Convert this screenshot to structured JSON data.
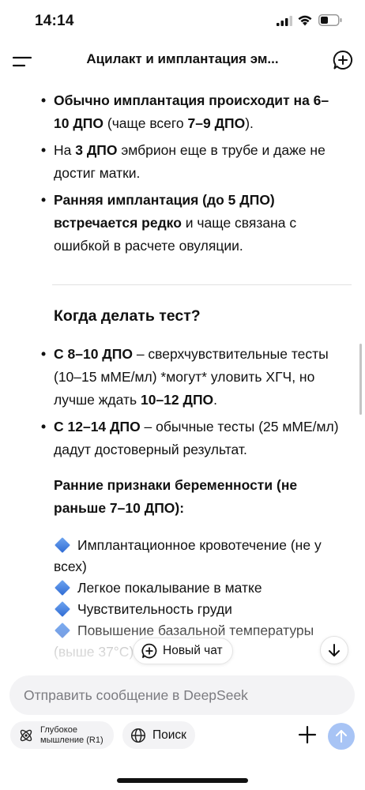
{
  "status_bar": {
    "time": "14:14"
  },
  "header": {
    "title": "Ацилакт и имплантация эм..."
  },
  "intro_bullets": [
    {
      "part1": "Обычно имплантация происходит на 6–10 ДПО",
      "part2": " (чаще всего ",
      "part3": "7–9 ДПО",
      "part4": ")."
    },
    {
      "part1": "На ",
      "part2": "3 ДПО",
      "part3": " эмбрион еще в трубе и даже не достиг матки."
    },
    {
      "part1": "Ранняя имплантация (до 5 ДПО) встречается редко",
      "part2": " и чаще связана с ошибкой в расчете овуляции."
    }
  ],
  "test_section": {
    "title": "Когда делать тест?",
    "bullets": [
      {
        "part1": "С 8–10 ДПО",
        "part2": " – сверхчувствительные тесты (10–15 мМЕ/мл) *могут* уловить ХГЧ, но лучше ждать ",
        "part3": "10–12 ДПО",
        "part4": "."
      },
      {
        "part1": "С 12–14 ДПО",
        "part2": " – обычные тесты (25 мМЕ/мл) дадут достоверный результат."
      }
    ]
  },
  "signs_section": {
    "title": "Ранние признаки беременности (не раньше 7–10 ДПО):",
    "items": [
      "Имплантационное кровотечение (не у всех)",
      "Легкое покалывание в матке",
      "Чувствительность груди",
      "Повышение базальной температуры",
      "(выше 37°C)"
    ]
  },
  "floating": {
    "new_chat_label": "Новый чат"
  },
  "composer": {
    "placeholder": "Отправить сообщение в DeepSeek",
    "deepthink_line1": "Глубокое",
    "deepthink_line2": "мышление (R1)",
    "search_label": "Поиск"
  },
  "colors": {
    "accent": "#4d6bfe",
    "send_disabled": "#a8c4f5",
    "diamond": "#2f6bd4"
  },
  "icons": [
    "signal-icon",
    "wifi-icon",
    "battery-icon",
    "menu-icon",
    "new-chat-icon",
    "diamond-icon",
    "arrow-down-icon",
    "atom-icon",
    "globe-icon",
    "plus-icon",
    "arrow-up-icon"
  ]
}
